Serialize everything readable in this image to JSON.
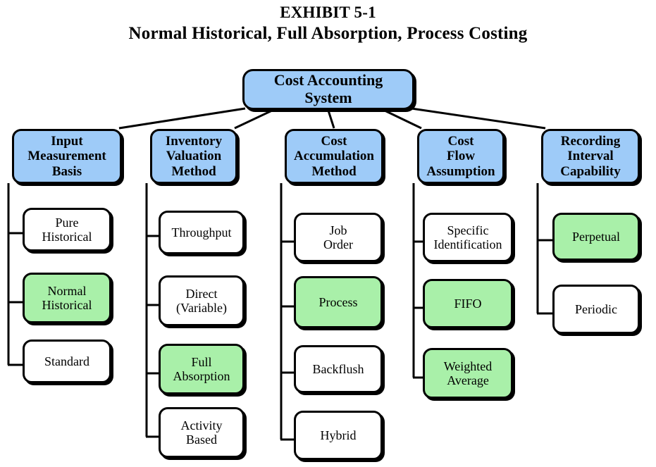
{
  "title": {
    "line1": "EXHIBIT 5-1",
    "line2": "Normal Historical, Full Absorption, Process Costing"
  },
  "colors": {
    "node_blue": "#9ecbf8",
    "node_green": "#a9f0a9",
    "node_white": "#ffffff",
    "outline": "#000000",
    "background": "#ffffff"
  },
  "root": {
    "label": "Cost Accounting\nSystem",
    "fill": "#9ecbf8"
  },
  "columns": [
    {
      "header": {
        "label": "Input\nMeasurement\nBasis",
        "fill": "#9ecbf8"
      },
      "items": [
        {
          "label": "Pure\nHistorical",
          "fill": "#ffffff",
          "highlighted": false
        },
        {
          "label": "Normal\nHistorical",
          "fill": "#a9f0a9",
          "highlighted": true
        },
        {
          "label": "Standard",
          "fill": "#ffffff",
          "highlighted": false
        }
      ]
    },
    {
      "header": {
        "label": "Inventory\nValuation\nMethod",
        "fill": "#9ecbf8"
      },
      "items": [
        {
          "label": "Throughput",
          "fill": "#ffffff",
          "highlighted": false
        },
        {
          "label": "Direct\n(Variable)",
          "fill": "#ffffff",
          "highlighted": false
        },
        {
          "label": "Full\nAbsorption",
          "fill": "#a9f0a9",
          "highlighted": true
        },
        {
          "label": "Activity\nBased",
          "fill": "#ffffff",
          "highlighted": false
        }
      ]
    },
    {
      "header": {
        "label": "Cost\nAccumulation\nMethod",
        "fill": "#9ecbf8"
      },
      "items": [
        {
          "label": "Job\nOrder",
          "fill": "#ffffff",
          "highlighted": false
        },
        {
          "label": "Process",
          "fill": "#a9f0a9",
          "highlighted": true
        },
        {
          "label": "Backflush",
          "fill": "#ffffff",
          "highlighted": false
        },
        {
          "label": "Hybrid",
          "fill": "#ffffff",
          "highlighted": false
        }
      ]
    },
    {
      "header": {
        "label": "Cost\nFlow\nAssumption",
        "fill": "#9ecbf8"
      },
      "items": [
        {
          "label": "Specific\nIdentification",
          "fill": "#ffffff",
          "highlighted": false
        },
        {
          "label": "FIFO",
          "fill": "#a9f0a9",
          "highlighted": true
        },
        {
          "label": "Weighted\nAverage",
          "fill": "#a9f0a9",
          "highlighted": true
        }
      ]
    },
    {
      "header": {
        "label": "Recording\nInterval\nCapability",
        "fill": "#9ecbf8"
      },
      "items": [
        {
          "label": "Perpetual",
          "fill": "#a9f0a9",
          "highlighted": true
        },
        {
          "label": "Periodic",
          "fill": "#ffffff",
          "highlighted": false
        }
      ]
    }
  ]
}
